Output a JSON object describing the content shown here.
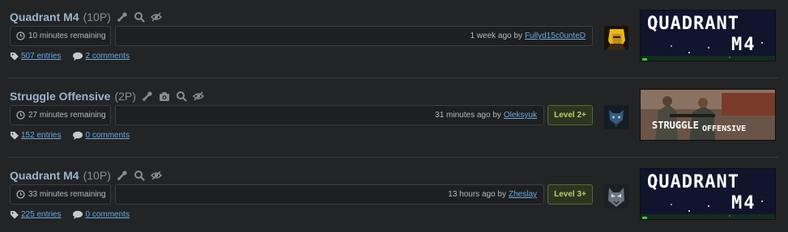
{
  "giveaways": [
    {
      "title": "Quadrant M4",
      "points": "(10P)",
      "time_remaining": "10 minutes remaining",
      "created": "1 week ago by",
      "creator": "Fullyd15c0unteD",
      "level": "",
      "entries": "507 entries",
      "comments": "2 comments",
      "image_text": [
        "QUADRANT",
        "M4"
      ]
    },
    {
      "title": "Struggle Offensive",
      "points": "(2P)",
      "time_remaining": "27 minutes remaining",
      "created": "31 minutes ago by",
      "creator": "Oleksyuk",
      "level": "Level 2+",
      "entries": "152 entries",
      "comments": "0 comments",
      "image_text": [
        "STRUGGLE",
        "OFFENSIVE"
      ]
    },
    {
      "title": "Quadrant M4",
      "points": "(10P)",
      "time_remaining": "33 minutes remaining",
      "created": "13 hours ago by",
      "creator": "Zheslay",
      "level": "Level 3+",
      "entries": "225 entries",
      "comments": "0 comments",
      "image_text": [
        "QUADRANT",
        "M4"
      ]
    }
  ],
  "icons": {
    "steam": "steam-icon",
    "search": "search-icon",
    "hide": "hide-icon",
    "screenshot": "camera-icon",
    "clock": "clock-icon",
    "tag": "tag-icon",
    "comment": "comment-bubble-icon"
  },
  "colors": {
    "background": "#222426",
    "title": "#9cb4cc",
    "link": "#6fa8dc",
    "level_text": "#b6d06a"
  }
}
